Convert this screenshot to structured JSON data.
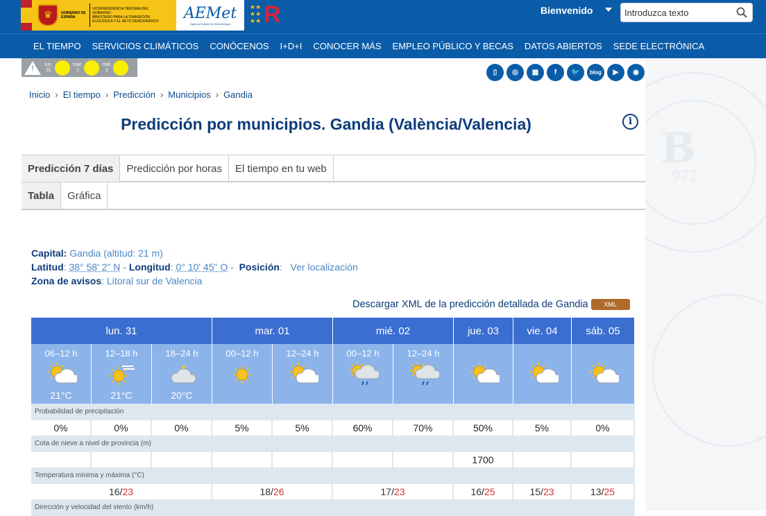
{
  "header": {
    "gov_text": "VICEPRESIDENCIA TERCERA DEL GOBIERNO",
    "gov_sub": "GOBIERNO DE ESPAÑA",
    "ministry": "MINISTERIO PARA LA TRANSICIÓN ECOLÓGICA Y EL RETO DEMOGRÁFICO",
    "aemet_logo": "AEMet",
    "aemet_sub": "Agencia Estatal de Meteorología",
    "welcome": "Bienvenido",
    "search_placeholder": "Introduzca texto"
  },
  "nav": [
    "EL TIEMPO",
    "SERVICIOS CLIMÁTICOS",
    "CONÓCENOS",
    "I+D+I",
    "CONOCER MÁS",
    "EMPLEO PÚBLICO Y BECAS",
    "DATOS ABIERTOS",
    "SEDE ELECTRÓNICA"
  ],
  "alerts": [
    {
      "day": "lun.",
      "num": "31",
      "color": "#f8f000"
    },
    {
      "day": "mar.",
      "num": "1",
      "color": "#f8f000"
    },
    {
      "day": "mié.",
      "num": "2",
      "color": "#f8f000"
    }
  ],
  "social_icons": [
    "mobile-icon",
    "radio-icon",
    "network-icon",
    "facebook-icon",
    "twitter-icon",
    "blog-icon",
    "youtube-icon",
    "rss-icon"
  ],
  "social_labels": {
    "facebook": "f",
    "blog": "blog"
  },
  "breadcrumb": [
    "Inicio",
    "El tiempo",
    "Predicción",
    "Municipios",
    "Gandia"
  ],
  "title": "Predicción por municipios. Gandia (València/Valencia)",
  "tabs_main": [
    "Predicción 7 días",
    "Predicción por horas",
    "El tiempo en tu web"
  ],
  "tabs_sub": [
    "Tabla",
    "Gráfica"
  ],
  "location": {
    "capital_label": "Capital:",
    "capital_value": "Gandia (altitud: 21 m)",
    "lat_label": "Latitud",
    "lat_value": "38° 58' 2\" N",
    "lon_label": "Longitud",
    "lon_value": "0° 10' 45\" O",
    "pos_label": "Posición",
    "pos_link": "Ver localización",
    "zone_label": "Zona de avisos",
    "zone_value": "Litoral sur de Valencia"
  },
  "xml": {
    "text": "Descargar XML de la predicción detallada de Gandia",
    "btn": "XML"
  },
  "forecast": {
    "days": [
      {
        "label": "lun. 31",
        "span": 3
      },
      {
        "label": "mar. 01",
        "span": 2
      },
      {
        "label": "mié. 02",
        "span": 2
      },
      {
        "label": "jue. 03",
        "span": 1
      },
      {
        "label": "vie. 04",
        "span": 1
      },
      {
        "label": "sáb. 05",
        "span": 1
      }
    ],
    "periods": [
      {
        "h": "06–12 h",
        "icon": "sun-cloud-icon",
        "temp": "21°C"
      },
      {
        "h": "12–18 h",
        "icon": "sun-haze-icon",
        "temp": "21°C"
      },
      {
        "h": "18–24 h",
        "icon": "moon-cloud-icon",
        "temp": "20°C"
      },
      {
        "h": "00–12 h",
        "icon": "sun-icon",
        "temp": ""
      },
      {
        "h": "12–24 h",
        "icon": "sun-cloud-icon",
        "temp": ""
      },
      {
        "h": "00–12 h",
        "icon": "sun-cloud-rain-icon",
        "temp": ""
      },
      {
        "h": "12–24 h",
        "icon": "sun-cloud-rain-icon",
        "temp": ""
      },
      {
        "h": "",
        "icon": "sun-cloud-icon",
        "temp": ""
      },
      {
        "h": "",
        "icon": "sun-cloud-icon",
        "temp": ""
      },
      {
        "h": "",
        "icon": "sun-cloud-icon",
        "temp": ""
      }
    ],
    "precip_label": "Probabilidad de precipitación",
    "precip": [
      "0%",
      "0%",
      "0%",
      "5%",
      "5%",
      "60%",
      "70%",
      "50%",
      "5%",
      "0%"
    ],
    "snow_label": "Cota de nieve a nivel de provincia (m)",
    "snow": [
      "",
      "",
      "",
      "",
      "",
      "",
      "",
      "1700",
      "",
      ""
    ],
    "temp_label": "Temperatura mínima y máxima (°C)",
    "temps": [
      {
        "min": "16",
        "max": "23"
      },
      {
        "min": "18",
        "max": "26"
      },
      {
        "min": "17",
        "max": "23"
      },
      {
        "min": "16",
        "max": "25"
      },
      {
        "min": "15",
        "max": "23"
      },
      {
        "min": "13",
        "max": "25"
      }
    ],
    "wind_label": "Dirección y velocidad del viento (km/h)"
  }
}
